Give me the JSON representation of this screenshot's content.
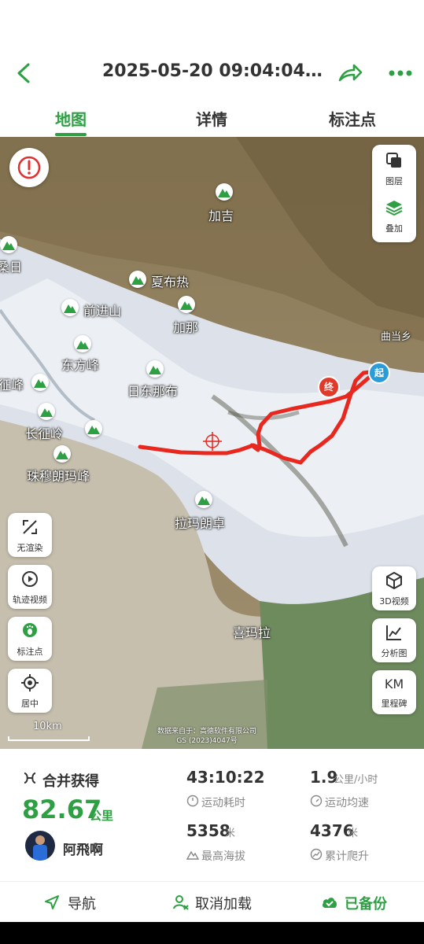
{
  "header": {
    "title": "2025-05-20 09:04:04+2...",
    "accent_color": "#2ea043"
  },
  "tabs": [
    {
      "label": "地图",
      "active": true
    },
    {
      "label": "详情",
      "active": false
    },
    {
      "label": "标注点",
      "active": false
    }
  ],
  "map": {
    "right_controls": {
      "layers": "图层",
      "overlay": "叠加",
      "video3d": "3D视频",
      "analysis": "分析图",
      "km": "KM",
      "milestones": "里程碑"
    },
    "left_controls": {
      "no_render": "无渲染",
      "track_video": "轨迹视频",
      "markers": "标注点",
      "center": "居中"
    },
    "places": {
      "jiaji": "加吉",
      "sangri": "桑日",
      "xiabure": "夏布热",
      "qianjinshan": "前进山",
      "jiana": "加那",
      "dongfangfeng": "东方峰",
      "changzhengfeng": "征峰",
      "ridongnabu": "日东那布",
      "changzhengling": "长征岭",
      "zhumulangma": "珠穆朗玛峰",
      "lamalangzhuo": "拉玛朗卓",
      "ximala": "喜玛拉",
      "qudangxiang": "曲当乡"
    },
    "start_marker": "起",
    "end_marker": "终",
    "route_color": "#e8271e",
    "scale": "10km",
    "attribution_1": "数据来自于：高德软件有限公司",
    "attribution_2": "GS (2023)4047号"
  },
  "stats": {
    "merged_label": "合并获得",
    "distance_value": "82.67",
    "distance_unit": "公里",
    "username": "阿飛啊",
    "duration_value": "43:10:22",
    "duration_label": "运动耗时",
    "speed_value": "1.9",
    "speed_unit": "公里/小时",
    "speed_label": "运动均速",
    "max_alt_value": "5358",
    "max_alt_unit": "米",
    "max_alt_label": "最高海拔",
    "climb_value": "4376",
    "climb_unit": "米",
    "climb_label": "累计爬升"
  },
  "bottom": {
    "navigate": "导航",
    "cancel_load": "取消加载",
    "backed_up": "已备份"
  }
}
